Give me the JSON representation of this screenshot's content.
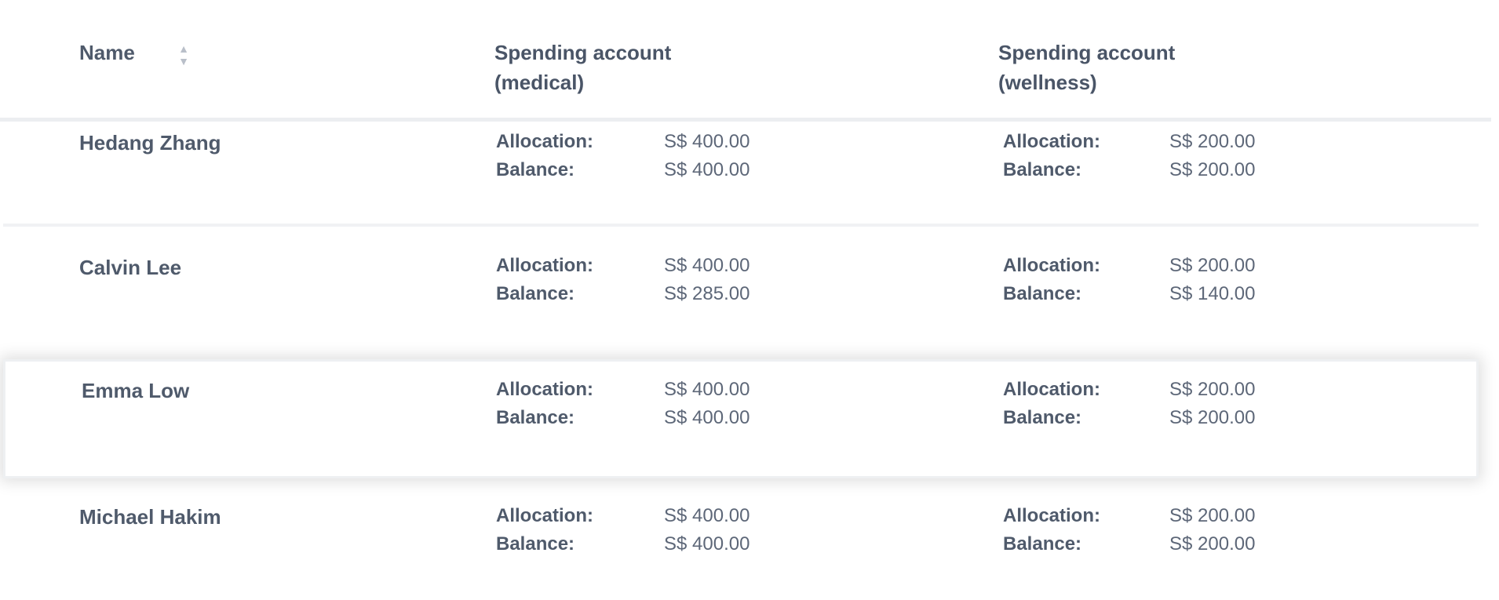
{
  "columns": {
    "name": "Name",
    "medical": "Spending account\n(medical)",
    "wellness": "Spending account\n(wellness)"
  },
  "sort_icon_up": "▲",
  "sort_icon_down": "▼",
  "labels": {
    "allocation": "Allocation:",
    "balance": "Balance:"
  },
  "rows": [
    {
      "name": "Hedang Zhang",
      "medical": {
        "allocation": "S$ 400.00",
        "balance": "S$ 400.00"
      },
      "wellness": {
        "allocation": "S$ 200.00",
        "balance": "S$ 200.00"
      }
    },
    {
      "name": "Calvin Lee",
      "medical": {
        "allocation": "S$ 400.00",
        "balance": "S$ 285.00"
      },
      "wellness": {
        "allocation": "S$ 200.00",
        "balance": "S$ 140.00"
      }
    },
    {
      "name": "Emma Low",
      "medical": {
        "allocation": "S$ 400.00",
        "balance": "S$ 400.00"
      },
      "wellness": {
        "allocation": "S$ 200.00",
        "balance": "S$ 200.00"
      }
    },
    {
      "name": "Michael Hakim",
      "medical": {
        "allocation": "S$ 400.00",
        "balance": "S$ 400.00"
      },
      "wellness": {
        "allocation": "S$ 200.00",
        "balance": "S$ 200.00"
      }
    }
  ]
}
